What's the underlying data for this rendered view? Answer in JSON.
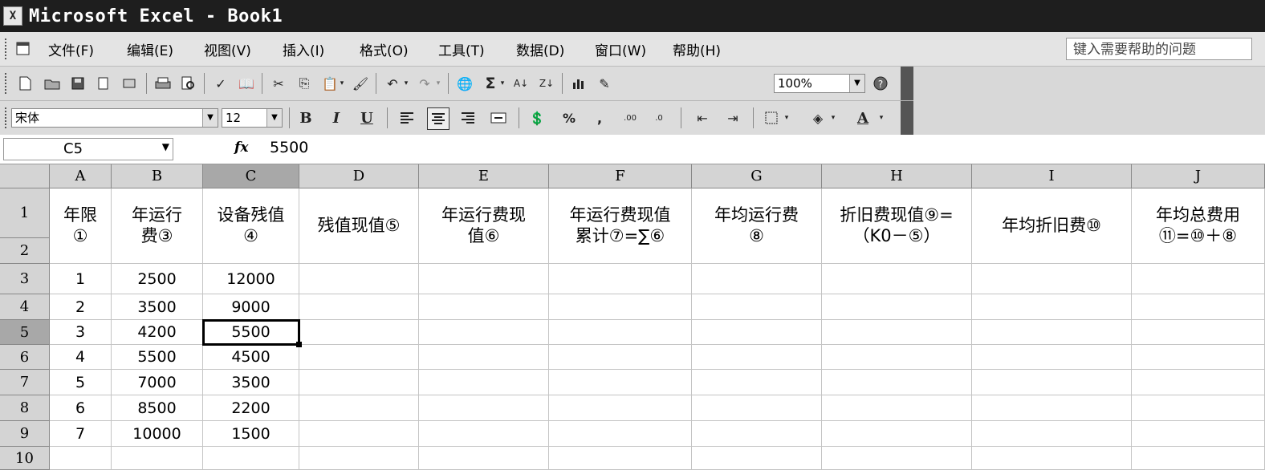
{
  "window": {
    "title": "Microsoft Excel - Book1"
  },
  "menu": {
    "items": [
      "文件(F)",
      "编辑(E)",
      "视图(V)",
      "插入(I)",
      "格式(O)",
      "工具(T)",
      "数据(D)",
      "窗口(W)",
      "帮助(H)"
    ]
  },
  "help": {
    "placeholder": "键入需要帮助的问题"
  },
  "standard_toolbar": {
    "zoom": "100%"
  },
  "formatting_toolbar": {
    "font": "宋体",
    "size": "12",
    "bold": "B",
    "italic": "I",
    "underline": "U"
  },
  "formula_bar": {
    "name_box": "C5",
    "fx": "fx",
    "value": "5500"
  },
  "sheet": {
    "columns": [
      "A",
      "B",
      "C",
      "D",
      "E",
      "F",
      "G",
      "H",
      "I",
      "J"
    ],
    "rows": [
      "1",
      "2",
      "3",
      "4",
      "5",
      "6",
      "7",
      "8",
      "9",
      "10"
    ],
    "headers": [
      "年限\n①",
      "年运行\n费③",
      "设备残值\n④",
      "残值现值⑤",
      "年运行费现\n值⑥",
      "年运行费现值\n累计⑦=∑⑥",
      "年均运行费\n⑧",
      "折旧费现值⑨=\n（K0－⑤）",
      "年均折旧费⑩",
      "年均总费用\n⑪=⑩＋⑧"
    ],
    "data": [
      [
        "1",
        "2500",
        "12000"
      ],
      [
        "2",
        "3500",
        "9000"
      ],
      [
        "3",
        "4200",
        "5500"
      ],
      [
        "4",
        "5500",
        "4500"
      ],
      [
        "5",
        "7000",
        "3500"
      ],
      [
        "6",
        "8500",
        "2200"
      ],
      [
        "7",
        "10000",
        "1500"
      ]
    ]
  }
}
